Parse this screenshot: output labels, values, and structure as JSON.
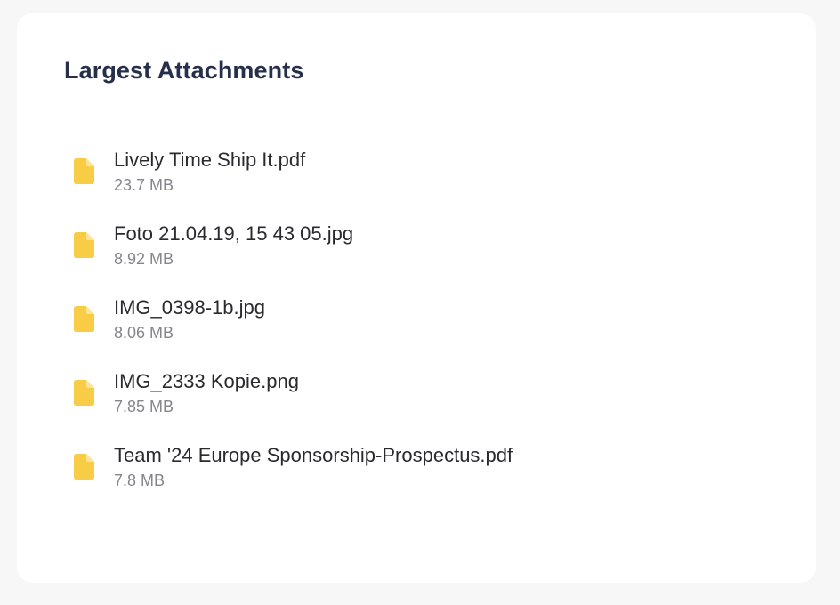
{
  "card": {
    "title": "Largest Attachments"
  },
  "attachments": [
    {
      "name": "Lively Time Ship It.pdf",
      "size": "23.7 MB",
      "icon": "file-icon"
    },
    {
      "name": "Foto 21.04.19, 15 43 05.jpg",
      "size": "8.92 MB",
      "icon": "file-icon"
    },
    {
      "name": "IMG_0398-1b.jpg",
      "size": "8.06 MB",
      "icon": "file-icon"
    },
    {
      "name": "IMG_2333 Kopie.png",
      "size": "7.85 MB",
      "icon": "file-icon"
    },
    {
      "name": "Team '24 Europe Sponsorship-Prospectus.pdf",
      "size": "7.8 MB",
      "icon": "file-icon"
    }
  ],
  "colors": {
    "background": "#f7f7f8",
    "card": "#ffffff",
    "title": "#26304a",
    "file_icon": "#f8cc45",
    "file_name": "#2a2a2e",
    "file_size": "#85858c"
  }
}
